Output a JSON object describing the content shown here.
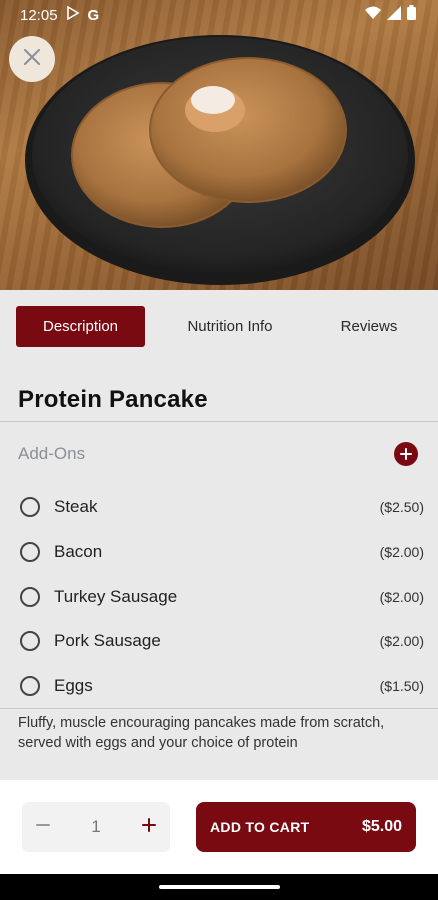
{
  "status_bar": {
    "time": "12:05",
    "icons": [
      "play-store-icon",
      "google-icon",
      "wifi-icon",
      "signal-icon",
      "battery-icon"
    ]
  },
  "hero": {
    "icons": [
      "close-icon"
    ]
  },
  "tabs": [
    {
      "label": "Description",
      "active": true
    },
    {
      "label": "Nutrition Info",
      "active": false
    },
    {
      "label": "Reviews",
      "active": false
    }
  ],
  "item": {
    "title": "Protein Pancake",
    "description": "Fluffy, muscle encouraging pancakes made from scratch, served with eggs and your choice of protein"
  },
  "addons": {
    "label": "Add-Ons",
    "options": [
      {
        "label": "Steak",
        "price": "($2.50)"
      },
      {
        "label": "Bacon",
        "price": "($2.00)"
      },
      {
        "label": "Turkey Sausage",
        "price": "($2.00)"
      },
      {
        "label": "Pork Sausage",
        "price": "($2.00)"
      },
      {
        "label": "Eggs",
        "price": "($1.50)"
      }
    ]
  },
  "cart": {
    "quantity": "1",
    "add_label": "ADD TO CART",
    "total": "$5.00"
  },
  "colors": {
    "accent": "#7a0a12",
    "sheet_bg": "#e9e9e9"
  }
}
